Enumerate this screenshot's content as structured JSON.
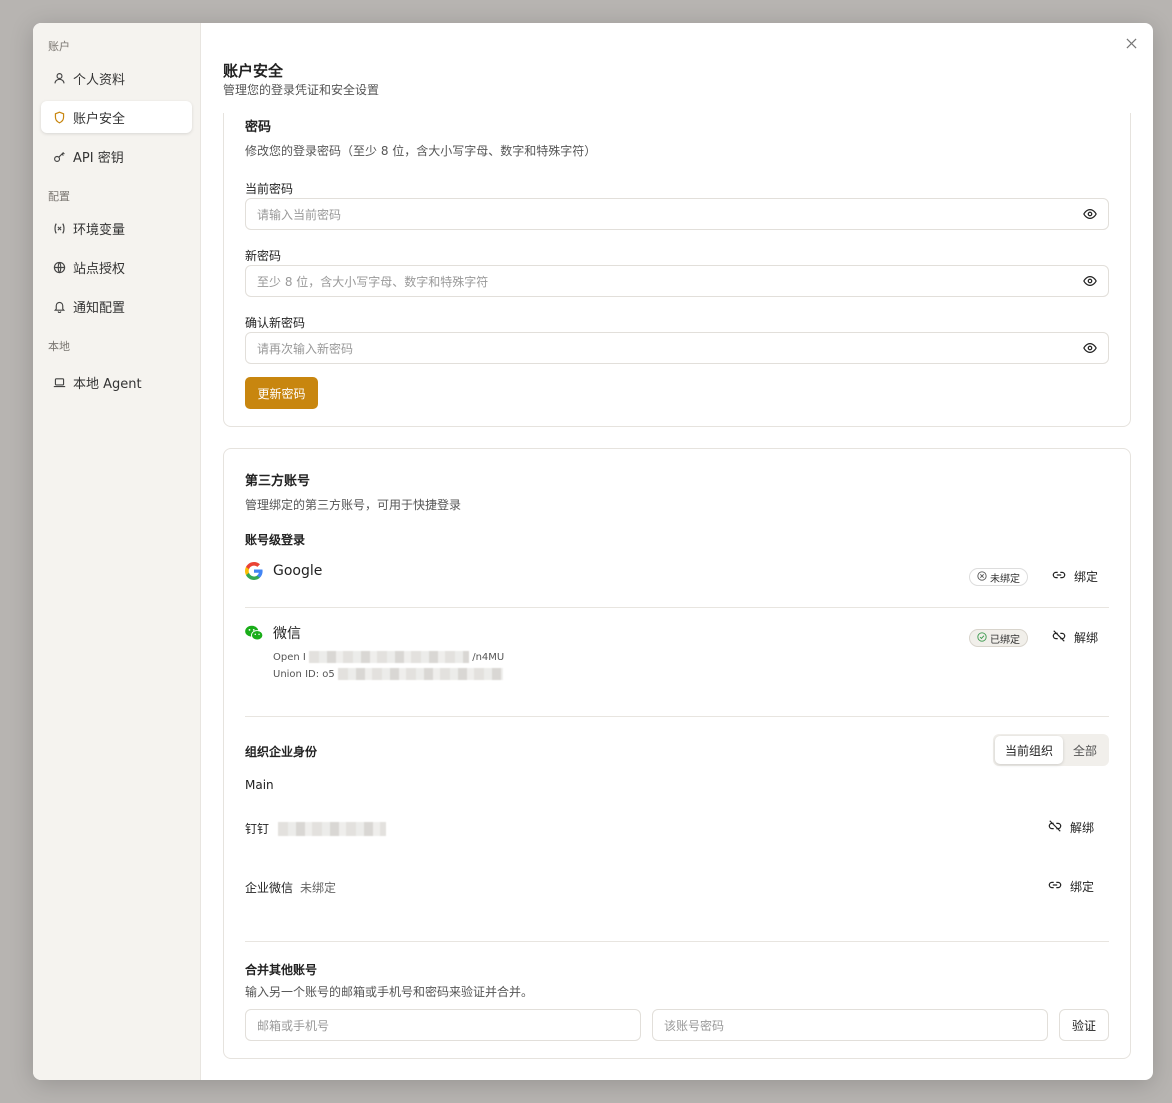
{
  "sidebar": {
    "sections": [
      {
        "title": "账户",
        "items": [
          {
            "label": "个人资料",
            "icon": "user-icon"
          },
          {
            "label": "账户安全",
            "icon": "shield-icon",
            "active": true
          },
          {
            "label": "API 密钥",
            "icon": "key-icon"
          }
        ]
      },
      {
        "title": "配置",
        "items": [
          {
            "label": "环境变量",
            "icon": "variable-icon"
          },
          {
            "label": "站点授权",
            "icon": "globe-icon"
          },
          {
            "label": "通知配置",
            "icon": "bell-icon"
          }
        ]
      },
      {
        "title": "本地",
        "items": [
          {
            "label": "本地 Agent",
            "icon": "laptop-icon"
          }
        ]
      }
    ]
  },
  "header": {
    "title": "账户安全",
    "subtitle": "管理您的登录凭证和安全设置"
  },
  "password": {
    "title": "密码",
    "subtitle": "修改您的登录密码（至少 8 位，含大小写字母、数字和特殊字符）",
    "current_label": "当前密码",
    "current_placeholder": "请输入当前密码",
    "new_label": "新密码",
    "new_placeholder": "至少 8 位，含大小写字母、数字和特殊字符",
    "confirm_label": "确认新密码",
    "confirm_placeholder": "请再次输入新密码",
    "submit_label": "更新密码"
  },
  "third_party": {
    "title": "第三方账号",
    "subtitle": "管理绑定的第三方账号，可用于快捷登录",
    "account_level_label": "账号级登录",
    "google": {
      "name": "Google",
      "status": "未绑定",
      "action": "绑定"
    },
    "wechat": {
      "name": "微信",
      "status": "已绑定",
      "action": "解绑",
      "open_id_label": "Open I",
      "open_id_suffix": "/n4MU",
      "union_id_label": "Union ID:",
      "union_id_prefix": "o5"
    },
    "org_label": "组织企业身份",
    "scope_current": "当前组织",
    "scope_all": "全部",
    "org_name": "Main",
    "dingtalk": {
      "name": "钉钉",
      "action": "解绑"
    },
    "wecom": {
      "name": "企业微信",
      "status": "未绑定",
      "action": "绑定"
    },
    "merge": {
      "title": "合并其他账号",
      "subtitle": "输入另一个账号的邮箱或手机号和密码来验证并合并。",
      "account_placeholder": "邮箱或手机号",
      "password_placeholder": "该账号密码",
      "verify_label": "验证"
    }
  },
  "colors": {
    "accent": "#c8860f",
    "wechat": "#1aad19",
    "bound_check": "#3c9a4f"
  }
}
